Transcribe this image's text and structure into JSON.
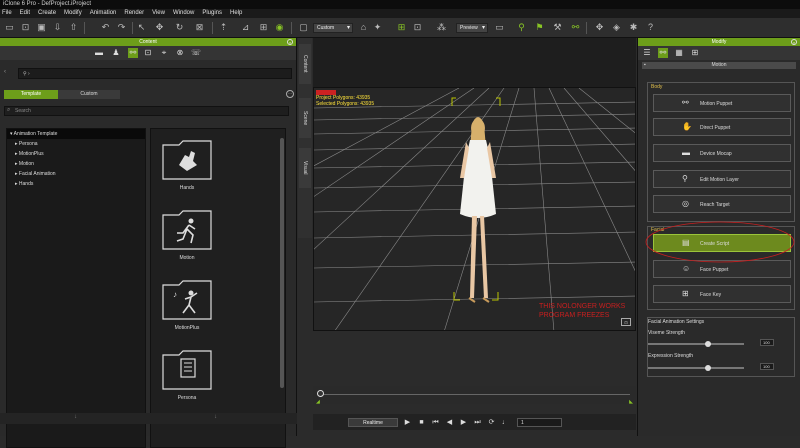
{
  "window": {
    "title": "iClone 6 Pro - DefProject.iProject"
  },
  "menu": [
    "File",
    "Edit",
    "Create",
    "Modify",
    "Animation",
    "Render",
    "View",
    "Window",
    "Plugins",
    "Help"
  ],
  "toolbar": {
    "render_mode": "Custom",
    "preview_mode": "Preview"
  },
  "content_panel": {
    "title": "Content",
    "tabs": [
      {
        "label": "Template"
      },
      {
        "label": "Custom"
      }
    ],
    "search_placeholder": "Search",
    "tree": [
      "Animation Template",
      "Persona",
      "MotionPlus",
      "Motion",
      "Facial Animation",
      "Hands"
    ],
    "thumbnails": [
      {
        "label": "Hands",
        "icon": "hand-icon"
      },
      {
        "label": "Motion",
        "icon": "running-figure-icon"
      },
      {
        "label": "MotionPlus",
        "icon": "dancing-figure-icon"
      },
      {
        "label": "Persona",
        "icon": "script-page-icon"
      }
    ]
  },
  "side_tabs": [
    "Content",
    "Scene",
    "Visual"
  ],
  "viewport": {
    "info_line1": "Project Polygons: 43935",
    "info_line2": "Selected Polygons: 43935",
    "annotation_line1": "THIS NOLONGER WORKS",
    "annotation_line2": "PROGRAM FREEZES"
  },
  "playback": {
    "mode": "Realtime",
    "frame": "1"
  },
  "modify_panel": {
    "title": "Modify",
    "section": "Motion",
    "body_label": "Body",
    "body_buttons": [
      "Motion Puppet",
      "Direct Puppet",
      "Device Mocap",
      "Edit Motion Layer",
      "Reach Target"
    ],
    "facial_label": "Facial",
    "facial_buttons": [
      "Create Script",
      "Face Puppet",
      "Face Key"
    ],
    "settings_title": "Facial Animation Settings",
    "viseme_label": "Viseme Strength",
    "viseme_value": "100",
    "expression_label": "Expression Strength",
    "expression_value": "100"
  }
}
